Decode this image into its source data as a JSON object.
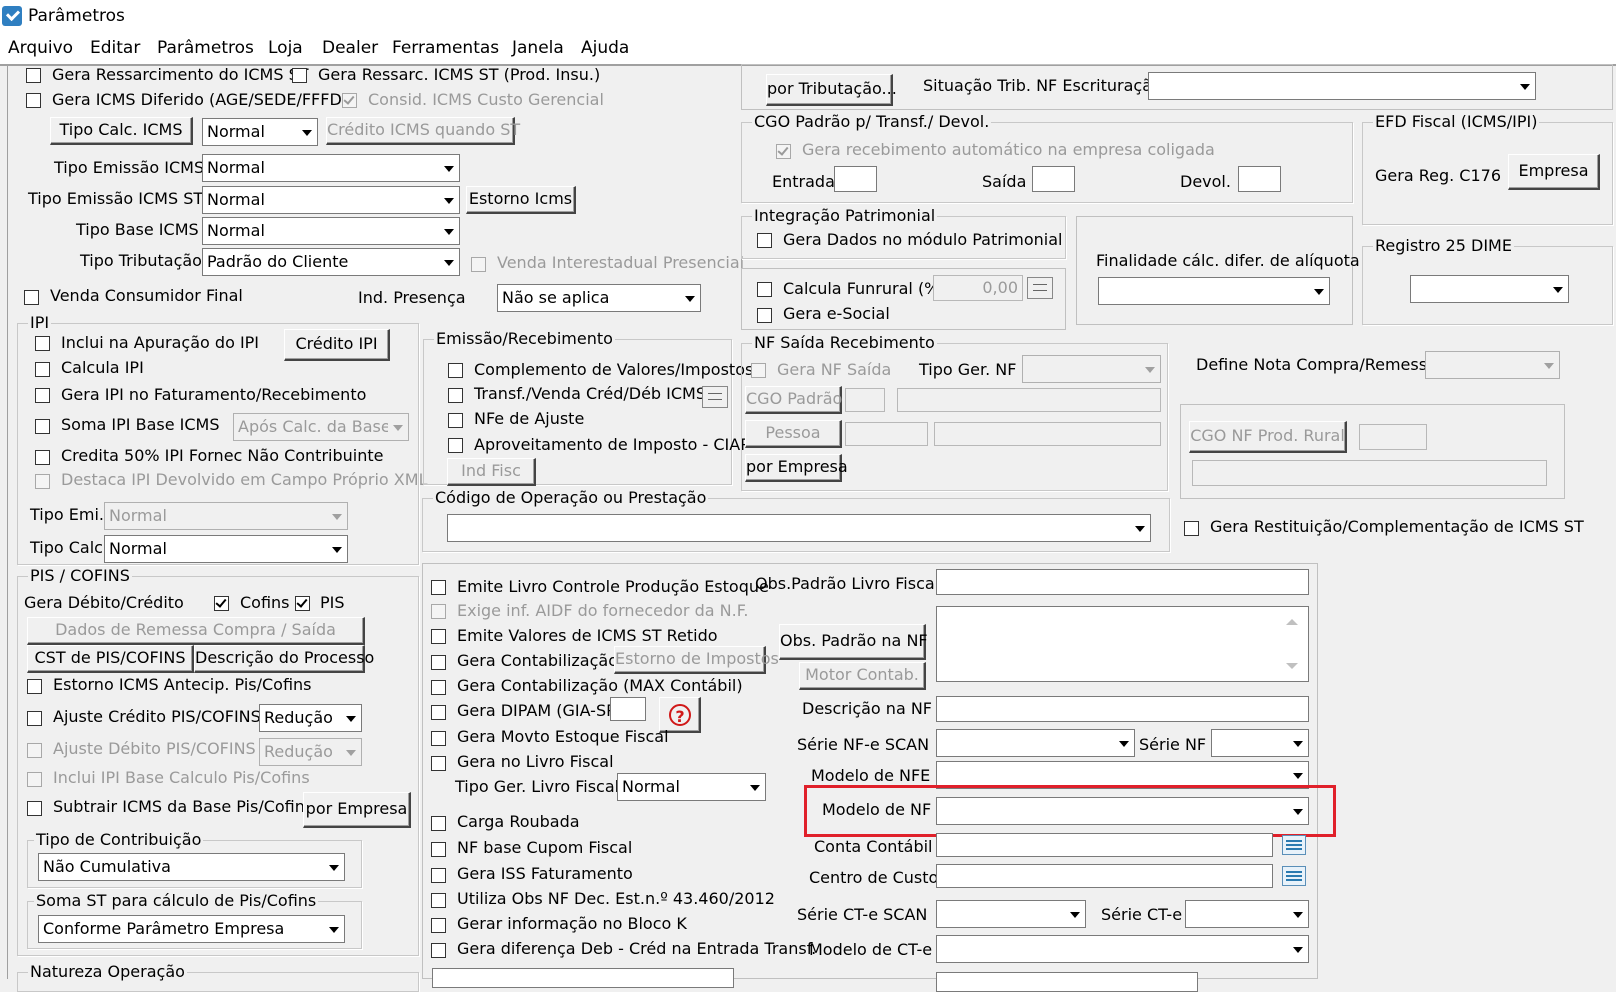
{
  "window": {
    "title": "Parâmetros"
  },
  "menu": [
    "Arquivo",
    "Editar",
    "Parâmetros",
    "Loja",
    "Dealer",
    "Ferramentas",
    "Janela",
    "Ajuda"
  ],
  "icms": {
    "gera_ressarcimento": "Gera Ressarcimento do ICMS ST",
    "gera_ressarc_prod": "Gera Ressarc. ICMS ST (Prod. Insu.)",
    "gera_diferido": "Gera ICMS Diferido (AGE/SEDE/FFFD)",
    "consid_custo": "Consid. ICMS Custo Gerencial",
    "tipo_calc_btn": "Tipo Calc. ICMS",
    "tipo_calc_value": "Normal",
    "credito_btn": "Crédito ICMS quando ST",
    "tipo_emissao_label": "Tipo Emissão ICMS",
    "tipo_emissao_value": "Normal",
    "tipo_emissao_st_label": "Tipo Emissão ICMS ST",
    "tipo_emissao_st_value": "Normal",
    "estorno_btn": "Estorno Icms",
    "tipo_base_label": "Tipo Base ICMS",
    "tipo_base_value": "Normal",
    "tipo_trib_label": "Tipo Tributação",
    "tipo_trib_value": "Padrão do Cliente",
    "venda_interestadual": "Venda Interestadual Presencial",
    "venda_consumidor": "Venda Consumidor Final",
    "ind_presenca_label": "Ind. Presença",
    "ind_presenca_value": "Não se aplica"
  },
  "ipi": {
    "title": "IPI",
    "inclui": "Inclui na Apuração do IPI",
    "credito_btn": "Crédito IPI",
    "calcula": "Calcula IPI",
    "gera_fat": "Gera IPI no Faturamento/Recebimento",
    "soma_base": "Soma IPI Base ICMS",
    "soma_base_value": "Após Calc. da Base",
    "credita50": "Credita 50% IPI Fornec Não Contribuinte",
    "destaca": "Destaca IPI Devolvido em Campo Próprio XML",
    "tipo_emi_label": "Tipo Emi.",
    "tipo_emi_value": "Normal",
    "tipo_calc_label": "Tipo Calc.",
    "tipo_calc_value": "Normal"
  },
  "pis": {
    "title": "PIS / COFINS",
    "gera_label": "Gera Débito/Crédito",
    "cofins": "Cofins",
    "pis": "PIS",
    "dados_remessa_btn": "Dados de Remessa Compra / Saída",
    "cst_btn": "CST de PIS/COFINS",
    "descricao_btn": "Descrição do Processo",
    "estorno": "Estorno ICMS Antecip. Pis/Cofins",
    "ajuste_credito": "Ajuste Crédito PIS/COFINS",
    "ajuste_credito_value": "Redução",
    "ajuste_debito": "Ajuste Débito PIS/COFINS",
    "ajuste_debito_value": "Redução",
    "inclui_ipi": "Inclui IPI Base Calculo Pis/Cofins",
    "subtrair": "Subtrair ICMS da Base Pis/Cofins",
    "por_empresa_btn": "por Empresa",
    "tipo_contrib_title": "Tipo de Contribuição",
    "tipo_contrib_value": "Não Cumulativa",
    "soma_st_title": "Soma ST para cálculo de Pis/Cofins",
    "soma_st_value": "Conforme Parâmetro Empresa",
    "natureza_title": "Natureza Operação"
  },
  "emissao": {
    "title": "Emissão/Recebimento",
    "complemento": "Complemento de Valores/Impostos",
    "transf": "Transf./Venda Créd/Déb ICMS",
    "nfe_ajuste": "NFe de Ajuste",
    "aproveitamento": "Aproveitamento de Imposto - CIAP",
    "ind_fisc_btn": "Ind Fisc"
  },
  "codigo_operacao": {
    "title": "Código de Operação ou Prestação",
    "value": ""
  },
  "top_right": {
    "por_tributacao_btn": "por Tributação...",
    "situacao_label": "Situação Trib. NF Escrituração",
    "cgo_title": "CGO Padrão p/ Transf./ Devol.",
    "gera_recebimento": "Gera recebimento automático na empresa coligada",
    "entrada": "Entrada",
    "saida": "Saída",
    "devol": "Devol.",
    "efd_title": "EFD Fiscal (ICMS/IPI)",
    "gera_reg": "Gera Reg. C176",
    "empresa_btn": "Empresa",
    "integracao_title": "Integração Patrimonial",
    "gera_dados": "Gera Dados no módulo Patrimonial",
    "finalidade": "Finalidade cálc. difer. de alíquota",
    "registro25_title": "Registro 25 DIME",
    "calcula_funrural": "Calcula Funrural (%)",
    "funrural_value": "0,00",
    "gera_esocial": "Gera e-Social"
  },
  "nf_saida": {
    "title": "NF Saída Recebimento",
    "gera_nf_saida": "Gera NF Saída",
    "tipo_ger_label": "Tipo Ger. NF",
    "cgo_padrao_btn": "CGO Padrão",
    "pessoa_btn": "Pessoa",
    "por_empresa_btn": "por Empresa",
    "define_nota": "Define Nota Compra/Remessa",
    "cgo_rural_btn": "CGO NF Prod. Rural",
    "gera_restituicao": "Gera Restituição/Complementação de ICMS ST"
  },
  "bottom": {
    "emite_livro": "Emite Livro Controle Produção Estoque",
    "exige_aidf": "Exige inf. AIDF do fornecedor da N.F.",
    "emite_valores": "Emite Valores de ICMS ST Retido",
    "gera_contab": "Gera Contabilização",
    "estorno_impostos_btn": "Estorno de Impostos",
    "gera_contab_max": "Gera Contabilização (MAX Contábil)",
    "gera_dipam": "Gera DIPAM (GIA-SP",
    "gera_movto": "Gera Movto Estoque Fiscal",
    "gera_livro": "Gera no Livro Fiscal",
    "tipo_ger_livro_label": "Tipo Ger. Livro Fiscal",
    "tipo_ger_livro_value": "Normal",
    "carga_roubada": "Carga Roubada",
    "nf_cupom": "NF base Cupom Fiscal",
    "gera_iss": "Gera ISS Faturamento",
    "utiliza_obs": "Utiliza Obs NF Dec. Est.n.º 43.460/2012",
    "gerar_bloco_k": "Gerar informação no Bloco K",
    "gera_diferenca": "Gera diferença Deb - Créd na Entrada Transf.",
    "obs_livro_label": "Obs.Padrão Livro Fiscal",
    "obs_nf_btn": "Obs. Padrão na NF",
    "motor_contab_btn": "Motor Contab.",
    "descricao_nf_label": "Descrição na NF",
    "serie_nfe_scan_label": "Série NF-e SCAN",
    "serie_nf_label": "Série NF",
    "modelo_nfe_label": "Modelo de NFE",
    "modelo_nf_label": "Modelo de NF",
    "conta_contabil_label": "Conta Contábil",
    "centro_custo_label": "Centro de Custo",
    "serie_cte_scan_label": "Série CT-e SCAN",
    "serie_cte_label": "Série CT-e",
    "modelo_cte_label": "Modelo de CT-e"
  },
  "accent_colors": {
    "highlight": "#e0202a",
    "help": "#d01818"
  }
}
